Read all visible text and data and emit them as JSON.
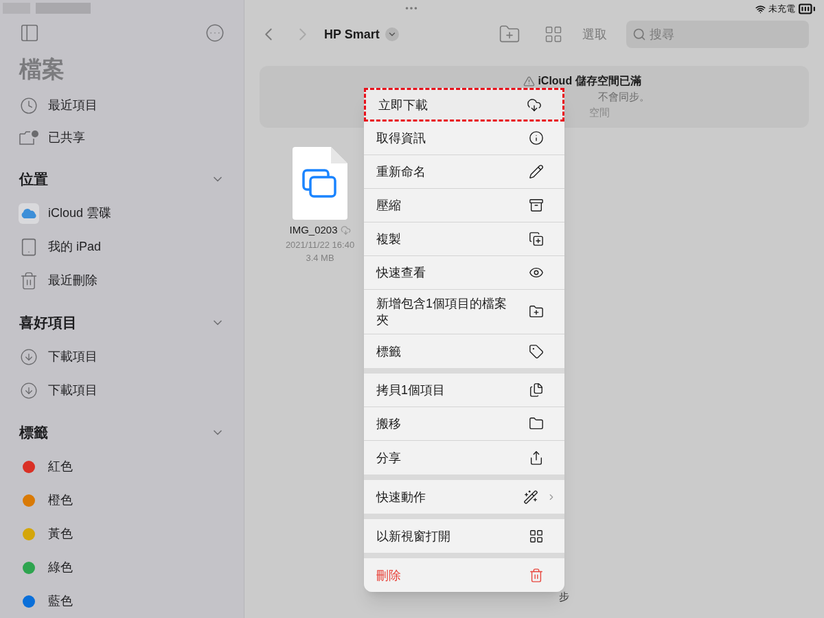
{
  "status_bar": {
    "battery_text": "未充電"
  },
  "sidebar": {
    "title": "檔案",
    "top_items": [
      {
        "label": "最近項目",
        "kind": "recent"
      },
      {
        "label": "已共享",
        "kind": "shared"
      }
    ],
    "sections": [
      {
        "title": "位置",
        "expanded": true,
        "items": [
          {
            "label": "iCloud 雲碟",
            "kind": "icloud"
          },
          {
            "label": "我的 iPad",
            "kind": "ipad"
          },
          {
            "label": "最近刪除",
            "kind": "trash"
          }
        ]
      },
      {
        "title": "喜好項目",
        "expanded": true,
        "items": [
          {
            "label": "下載項目",
            "kind": "download"
          },
          {
            "label": "下載項目",
            "kind": "download"
          }
        ]
      },
      {
        "title": "標籤",
        "expanded": true,
        "items": [
          {
            "label": "紅色",
            "kind": "tag",
            "color": "#d93025"
          },
          {
            "label": "橙色",
            "kind": "tag",
            "color": "#d97a06"
          },
          {
            "label": "黃色",
            "kind": "tag",
            "color": "#d4a60a"
          },
          {
            "label": "綠色",
            "kind": "tag",
            "color": "#2ea44f"
          },
          {
            "label": "藍色",
            "kind": "tag",
            "color": "#0a6fd9"
          }
        ]
      }
    ]
  },
  "toolbar": {
    "folder": "HP Smart",
    "select": "選取",
    "search_placeholder": "搜尋"
  },
  "banner": {
    "title": "iCloud 儲存空間已滿",
    "line_1": "不會同步。",
    "line_2": "空間",
    "bottom_fragment": "步"
  },
  "file": {
    "name": "IMG_0203",
    "in_cloud": true,
    "date": "2021/11/22 16:40",
    "size": "3.4 MB"
  },
  "menu": {
    "groups": [
      {
        "items": [
          {
            "label": "立即下載",
            "kind": "action",
            "highlighted": true
          },
          {
            "label": "取得資訊",
            "kind": "action",
            "highlighted": false
          },
          {
            "label": "重新命名",
            "kind": "action",
            "highlighted": false
          },
          {
            "label": "壓縮",
            "kind": "action",
            "highlighted": false
          },
          {
            "label": "複製",
            "kind": "action",
            "highlighted": false
          },
          {
            "label": "快速查看",
            "kind": "action",
            "highlighted": false
          },
          {
            "label": "新增包含1個項目的檔案夾",
            "kind": "action",
            "highlighted": false
          },
          {
            "label": "標籤",
            "kind": "action",
            "highlighted": false
          }
        ]
      },
      {
        "items": [
          {
            "label": "拷貝1個項目",
            "kind": "action",
            "highlighted": false
          },
          {
            "label": "搬移",
            "kind": "action",
            "highlighted": false
          },
          {
            "label": "分享",
            "kind": "action",
            "highlighted": false
          }
        ]
      },
      {
        "items": [
          {
            "label": "快速動作",
            "kind": "submenu",
            "highlighted": false
          }
        ]
      },
      {
        "items": [
          {
            "label": "以新視窗打開",
            "kind": "action",
            "highlighted": false
          }
        ]
      },
      {
        "items": [
          {
            "label": "刪除",
            "kind": "destructive",
            "highlighted": false
          }
        ]
      }
    ]
  }
}
